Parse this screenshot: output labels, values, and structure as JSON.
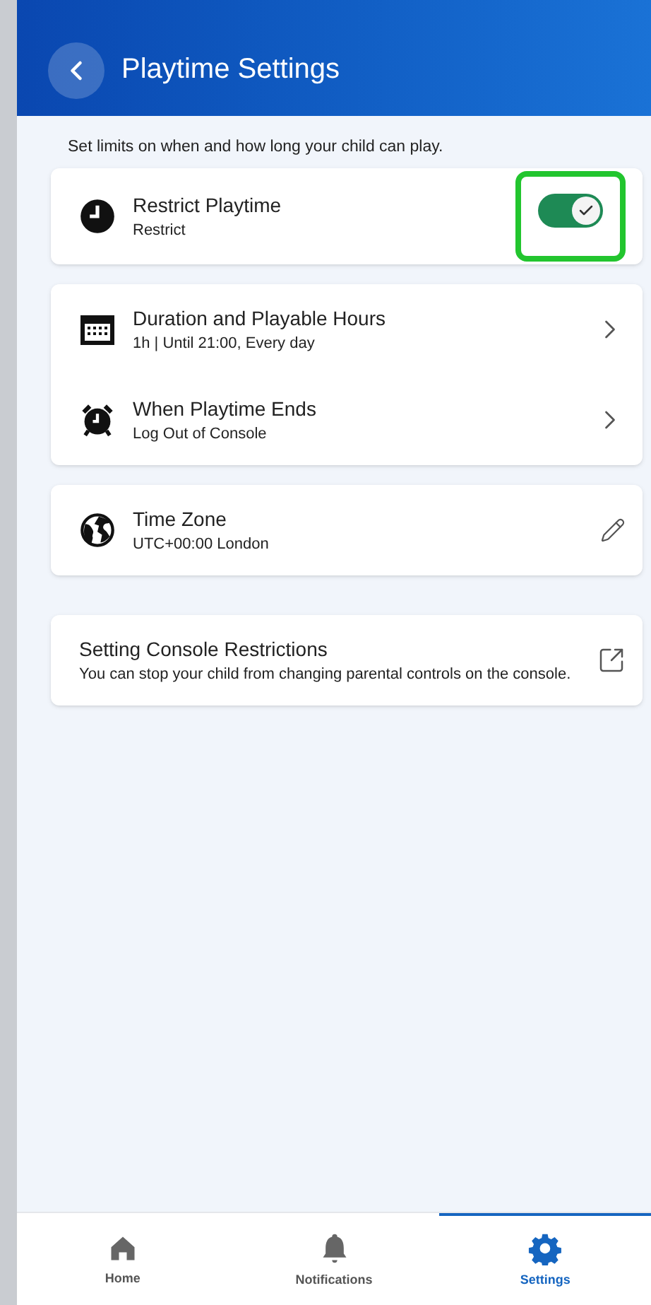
{
  "header": {
    "title": "Playtime Settings"
  },
  "intro": "Set limits on when and how long your child can play.",
  "groups": [
    {
      "items": [
        {
          "kind": "toggle",
          "title": "Restrict Playtime",
          "subtitle": "Restrict",
          "on": true,
          "highlighted": true
        }
      ]
    },
    {
      "items": [
        {
          "kind": "link",
          "title": "Duration and Playable Hours",
          "subtitle": "1h | Until 21:00, Every day"
        },
        {
          "kind": "link",
          "title": "When Playtime Ends",
          "subtitle": "Log Out of Console"
        }
      ]
    },
    {
      "items": [
        {
          "kind": "edit",
          "title": "Time Zone",
          "subtitle": "UTC+00:00 London"
        }
      ]
    },
    {
      "items": [
        {
          "kind": "external",
          "title": "Setting Console Restrictions",
          "subtitle": "You can stop your child from changing parental controls on the console."
        }
      ]
    }
  ],
  "tabs": [
    {
      "label": "Home",
      "selected": false
    },
    {
      "label": "Notifications",
      "selected": false
    },
    {
      "label": "Settings",
      "selected": true
    }
  ]
}
